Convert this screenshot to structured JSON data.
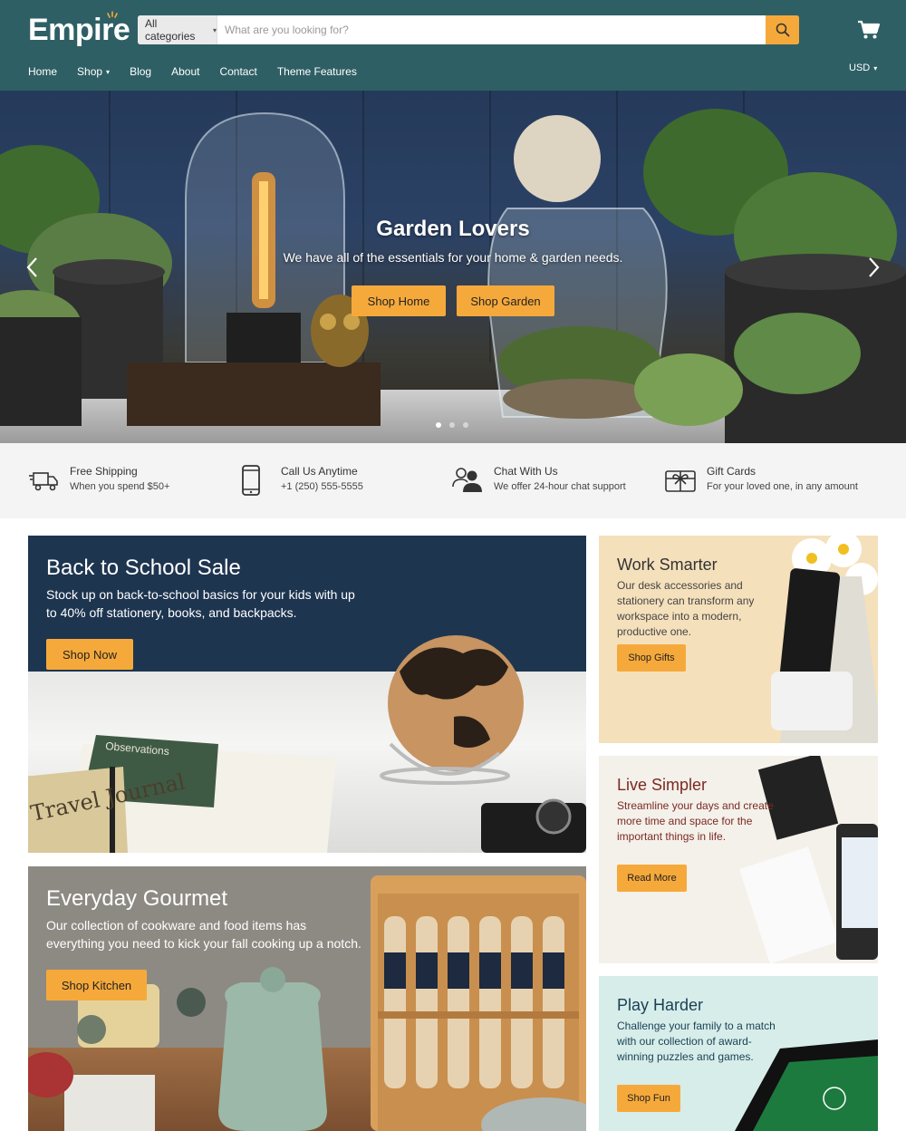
{
  "header": {
    "logo": "Empire",
    "search": {
      "category": "All categories",
      "placeholder": "What are you looking for?"
    },
    "nav": [
      "Home",
      "Shop",
      "Blog",
      "About",
      "Contact",
      "Theme Features"
    ],
    "currency": "USD",
    "colors": {
      "header_bg": "#2e5f65",
      "accent": "#f6a93b"
    }
  },
  "hero": {
    "title": "Garden Lovers",
    "subtitle": "We have all of the essentials for your home & garden needs.",
    "buttons": [
      "Shop Home",
      "Shop Garden"
    ],
    "slides_total": 3,
    "active_slide": 1
  },
  "features": [
    {
      "icon": "truck-icon",
      "title": "Free Shipping",
      "text": "When you spend $50+"
    },
    {
      "icon": "phone-icon",
      "title": "Call Us Anytime",
      "text": "+1 (250) 555-5555"
    },
    {
      "icon": "chat-users-icon",
      "title": "Chat With Us",
      "text": "We offer 24-hour chat support"
    },
    {
      "icon": "gift-card-icon",
      "title": "Gift Cards",
      "text": "For your loved one, in any amount"
    }
  ],
  "promos": {
    "back_to_school": {
      "title": "Back to School Sale",
      "text": "Stock up on back-to-school basics for your kids with up to 40% off stationery, books, and backpacks.",
      "button": "Shop Now",
      "journal_text": "Travel Journal",
      "notebook_text": "Observations"
    },
    "everyday_gourmet": {
      "title": "Everyday Gourmet",
      "text": "Our collection of cookware and food items has everything you need to kick your fall cooking up a notch.",
      "button": "Shop Kitchen"
    },
    "work_smarter": {
      "title": "Work Smarter",
      "text": "Our desk accessories and stationery can transform any workspace into a modern, productive one.",
      "button": "Shop Gifts"
    },
    "live_simpler": {
      "title": "Live Simpler",
      "text": "Streamline your days and create more time and space for the important things in life.",
      "button": "Read More"
    },
    "play_harder": {
      "title": "Play Harder",
      "text": "Challenge your family to a match with our collection of award-winning puzzles and games.",
      "button": "Shop Fun"
    }
  }
}
